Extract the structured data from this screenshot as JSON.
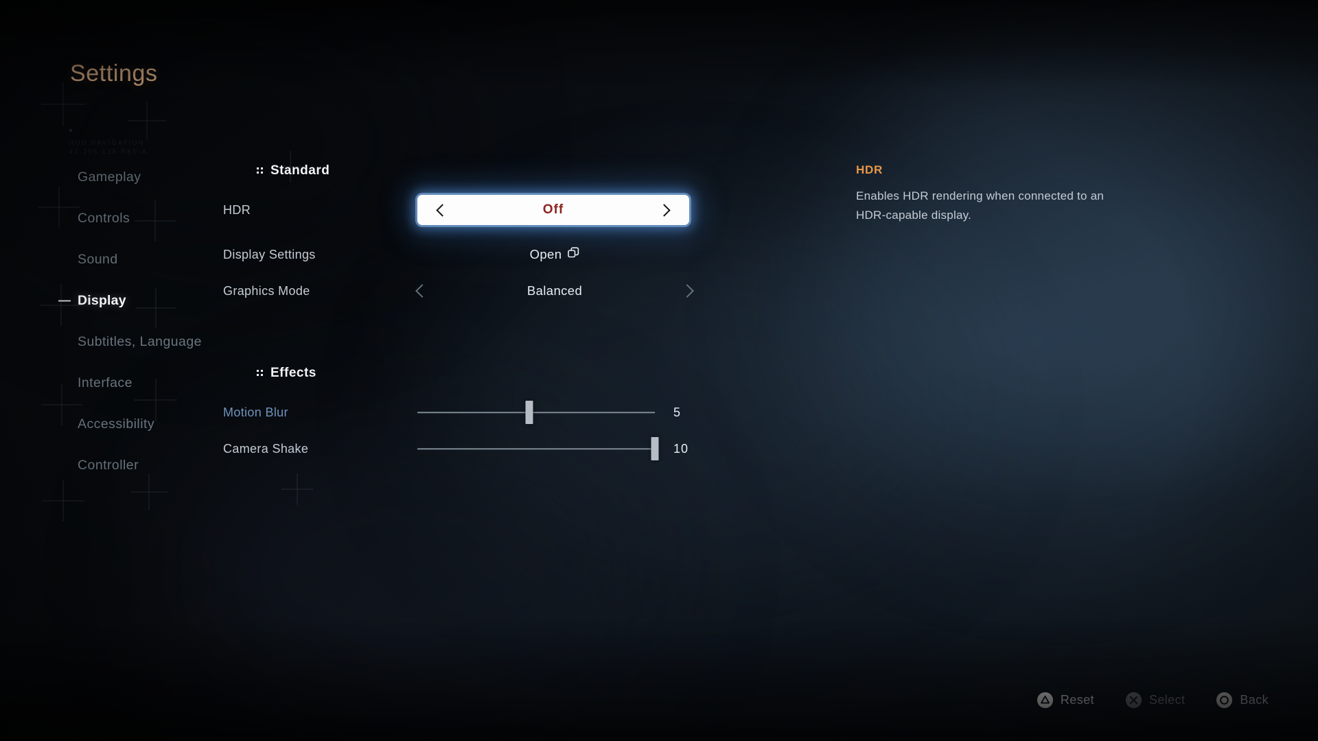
{
  "header": {
    "title": "Settings",
    "deco_code": "HUD NAVIGATION\n41-255-128-REF-A"
  },
  "sidebar": {
    "items": [
      {
        "label": "Gameplay",
        "active": false
      },
      {
        "label": "Controls",
        "active": false
      },
      {
        "label": "Sound",
        "active": false
      },
      {
        "label": "Display",
        "active": true
      },
      {
        "label": "Subtitles, Language",
        "active": false
      },
      {
        "label": "Interface",
        "active": false
      },
      {
        "label": "Accessibility",
        "active": false
      },
      {
        "label": "Controller",
        "active": false
      }
    ]
  },
  "sections": {
    "standard": {
      "title": "Standard",
      "hdr": {
        "label": "HDR",
        "value": "Off"
      },
      "display_settings": {
        "label": "Display Settings",
        "value": "Open"
      },
      "graphics_mode": {
        "label": "Graphics Mode",
        "value": "Balanced"
      }
    },
    "effects": {
      "title": "Effects",
      "motion_blur": {
        "label": "Motion Blur",
        "value": "5"
      },
      "camera_shake": {
        "label": "Camera Shake",
        "value": "10"
      }
    }
  },
  "description": {
    "title": "HDR",
    "body": "Enables HDR rendering when connected to an HDR-capable display."
  },
  "footer": {
    "reset": "Reset",
    "select": "Select",
    "back": "Back"
  },
  "colors": {
    "title_accent": "#e8b98e",
    "desc_accent": "#e7974a",
    "focus_value": "#8d2420",
    "modified_label": "#6f93bb",
    "focus_glow": "#5a96dc"
  },
  "sliders": {
    "motion_blur_pct": 47,
    "camera_shake_pct": 100
  }
}
